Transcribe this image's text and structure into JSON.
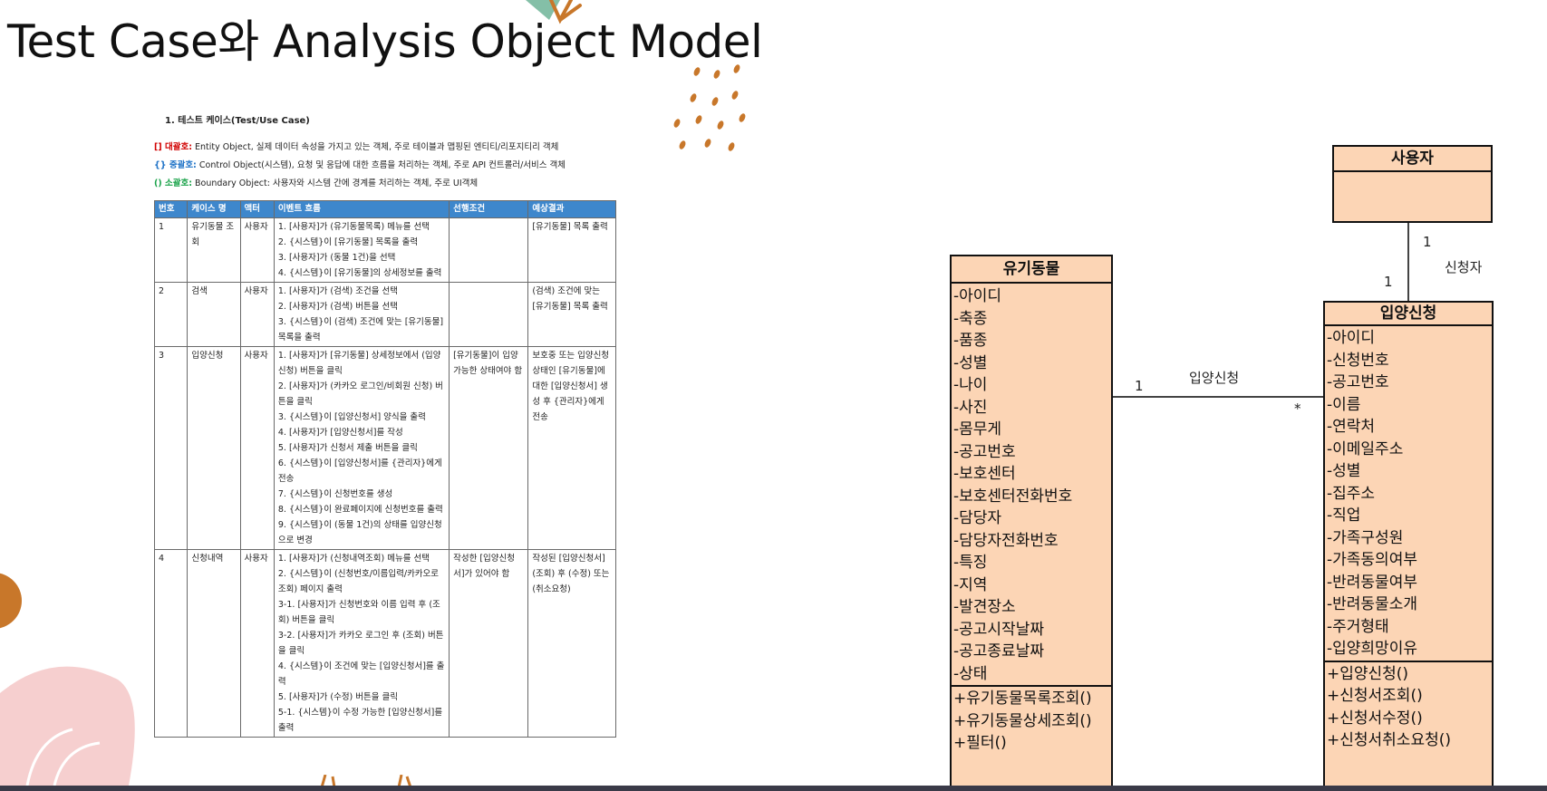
{
  "slide": {
    "title": "Test Case와 Analysis Object Model"
  },
  "colors": {
    "table_header": "#3e87cc",
    "uml_fill": "#fcd5b5",
    "red_tag": "#d10000",
    "blue_tag": "#1f73c7",
    "green_tag": "#1aa34a",
    "deco_brown": "#c8772a",
    "deco_pink": "#f6cfcf",
    "deco_teal": "#84bfa7"
  },
  "document": {
    "heading": "1.  테스트 케이스(Test/Use Case)",
    "legend": [
      {
        "key": "[] 대괄호:",
        "text": " Entity Object, 실제 데이터 속성을 가지고 있는 객체, 주로 테이블과 맵핑된 엔티티/리포지티리 객체",
        "color": "red"
      },
      {
        "key": "{} 중괄호:",
        "text": " Control Object(시스템), 요청 및 응답에 대한 흐름을 처리하는 객체, 주로 API 컨트롤러/서비스 객체",
        "color": "blue"
      },
      {
        "key": "() 소괄호:",
        "text": " Boundary Object: 사용자와 시스템 간에 경계를 처리하는 객체, 주로 UI객체",
        "color": "green"
      }
    ],
    "table": {
      "headers": [
        "번호",
        "케이스 명",
        "액터",
        "이벤트 흐름",
        "선행조건",
        "예상결과"
      ],
      "rows": [
        {
          "no": "1",
          "name": "유기동물 조회",
          "actor": "사용자",
          "flow": [
            "1. [사용자]가 (유기동물목록) 메뉴를 선택",
            "2. {시스템}이 [유기동물] 목록을 출력",
            "3. [사용자]가 (동물 1건)을 선택",
            "4. {시스템}이 [유기동물]의 상세정보를 출력"
          ],
          "pre": "",
          "result": "[유기동물] 목록 출력"
        },
        {
          "no": "2",
          "name": "검색",
          "actor": "사용자",
          "flow": [
            "1. [사용자]가 (검색) 조건을 선택",
            "2. [사용자]가 (검색) 버튼을 선택",
            "3. {시스템}이 (검색) 조건에 맞는 [유기동물] 목록을 출력"
          ],
          "pre": "",
          "result": "(검색) 조건에 맞는 [유기동물] 목록 출력"
        },
        {
          "no": "3",
          "name": "입양신청",
          "actor": "사용자",
          "flow": [
            "1. [사용자]가 [유기동물] 상세정보에서 (입양신청) 버튼을 클릭",
            "2. [사용자]가 (카카오 로그인/비회원 신청) 버튼을 클릭",
            "3. {시스템}이 [입양신청서] 양식을 출력",
            "4. [사용자]가 [입양신청서]를 작성",
            "5. [사용자]가 신청서 제출 버튼을 클릭",
            "6. {시스템}이 [입양신청서]를 {관리자}에게 전송",
            "7. {시스템}이 신청번호를 생성",
            "8. {시스템}이 완료페이지에 신청번호를 출력",
            "9. {시스템}이 (동물 1건)의 상태를 입양신청으로 변경"
          ],
          "pre": "[유기동물]이 입양 가능한 상태여야 함",
          "result": "보호중 또는 입양신청 상태인 [유기동물]에 대한 [입양신청서] 생성 후 {관리자}에게 전송"
        },
        {
          "no": "4",
          "name": "신청내역",
          "actor": "사용자",
          "flow": [
            "1. [사용자]가 (신청내역조회) 메뉴를 선택",
            "2. {시스템}이 (신청번호/이름입력/카카오로 조회) 페이지 출력",
            "3-1. [사용자]가 신청번호와 이름 입력 후 (조회) 버튼을 클릭",
            "3-2. [사용자]가 카카오 로그인 후 (조회) 버튼을 클릭",
            "4. {시스템}이 조건에 맞는 [입양신청서]를 출력",
            "5. [사용자]가 (수정) 버튼을 클릭",
            "5-1. {시스템}이 수정 가능한 [입양신청서]를 출력"
          ],
          "pre": "작성한 [입양신청서]가 있어야 함",
          "result": "작성된 [입양신청서] (조회) 후 (수정) 또는 (취소요청)"
        }
      ]
    }
  },
  "uml": {
    "user": {
      "name": "사용자"
    },
    "animal": {
      "name": "유기동물",
      "attributes": [
        "-아이디",
        "-축종",
        "-품종",
        "-성별",
        "-나이",
        "-사진",
        "-몸무게",
        "-공고번호",
        "-보호센터",
        "-보호센터전화번호",
        "-담당자",
        "-담당자전화번호",
        "-특징",
        "-지역",
        "-발견장소",
        "-공고시작날짜",
        "-공고종료날짜",
        "-상태"
      ],
      "operations": [
        "+유기동물목록조회()",
        "+유기동물상세조회()",
        "+필터()"
      ]
    },
    "adoption": {
      "name": "입양신청",
      "attributes": [
        "-아이디",
        "-신청번호",
        "-공고번호",
        "-이름",
        "-연락처",
        "-이메일주소",
        "-성별",
        "-집주소",
        "-직업",
        "-가족구성원",
        "-가족동의여부",
        "-반려동물여부",
        "-반려동물소개",
        "-주거형태",
        "-입양희망이유"
      ],
      "operations": [
        "+입양신청()",
        "+신청서조회()",
        "+신청서수정()",
        "+신청서취소요청()"
      ]
    },
    "assoc_user": {
      "role": "신청자",
      "mult_user": "1",
      "mult_adopt": "1"
    },
    "assoc_animal": {
      "label": "입양신청",
      "mult_animal": "1",
      "mult_adopt": "*"
    }
  }
}
